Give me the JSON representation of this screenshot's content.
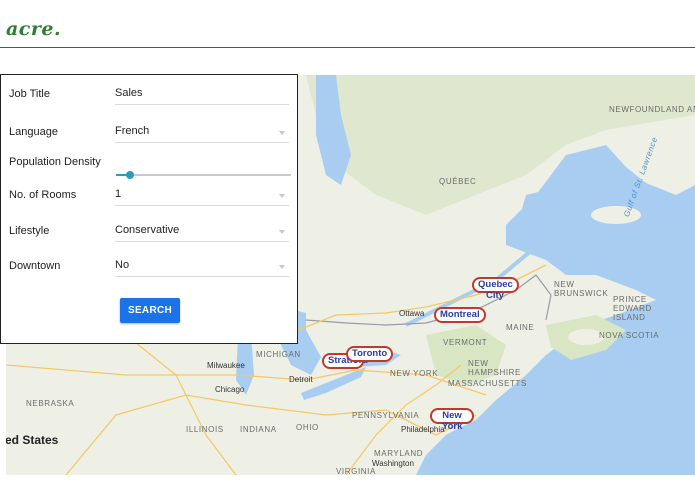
{
  "header": {
    "logo": "acre."
  },
  "form": {
    "job_title_label": "Job Title",
    "job_title_value": "Sales",
    "language_label": "Language",
    "language_value": "French",
    "population_label": "Population Density",
    "population_level": 0.08,
    "rooms_label": "No. of Rooms",
    "rooms_value": "1",
    "lifestyle_label": "Lifestyle",
    "lifestyle_value": "Conservative",
    "downtown_label": "Downtown",
    "downtown_value": "No",
    "search_label": "SEARCH",
    "accent_color": "#26a0b8",
    "button_color": "#1a73e8"
  },
  "map": {
    "regions": [
      "NEWFOUNDLAND AND LABRADOR",
      "QUÉBEC",
      "NEW BRUNSWICK",
      "PRINCE EDWARD ISLAND",
      "NOVA SCOTIA",
      "MAINE",
      "VERMONT",
      "NEW HAMPSHIRE",
      "NEW YORK",
      "MASSACHUSETTS",
      "MICHIGAN",
      "NEBRASKA",
      "ILLINOIS",
      "INDIANA",
      "OHIO",
      "PENNSYLVANIA",
      "MARYLAND",
      "VIRGINIA"
    ],
    "water": [
      "Gulf of St. Lawrence"
    ],
    "cities": [
      "Ottawa",
      "Milwaukee",
      "Chicago",
      "Detroit",
      "Philadelphia",
      "Washington"
    ],
    "country": "ed States",
    "markers": [
      {
        "line1": "Quebec",
        "line2": "City"
      },
      {
        "line1": "Montreal"
      },
      {
        "line1": "Toronto"
      },
      {
        "line1": "Stratford"
      },
      {
        "line1": "New",
        "line2": "York"
      }
    ],
    "marker_color": "#c0392b"
  }
}
